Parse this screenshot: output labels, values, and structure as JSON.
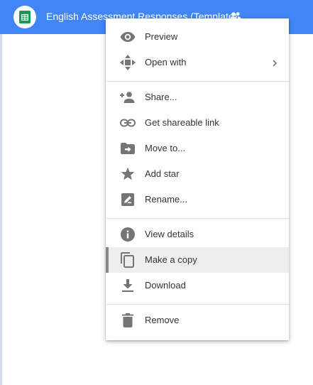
{
  "header": {
    "title": "English Assessment Responses (Template)",
    "file_icon": "google-sheets-icon",
    "shared_icon": "people-icon",
    "bar_color": "#4285f4"
  },
  "menu": {
    "hover_color": "#eeeeee",
    "items": [
      {
        "label": "Preview",
        "icon": "eye-icon"
      },
      {
        "label": "Open with",
        "icon": "move-arrows-icon",
        "submenu": "chevron-right-icon"
      },
      {
        "label": "Share...",
        "icon": "add-person-icon"
      },
      {
        "label": "Get shareable link",
        "icon": "link-icon"
      },
      {
        "label": "Move to...",
        "icon": "folder-move-icon"
      },
      {
        "label": "Add star",
        "icon": "star-icon"
      },
      {
        "label": "Rename...",
        "icon": "rename-icon"
      },
      {
        "label": "View details",
        "icon": "info-icon"
      },
      {
        "label": "Make a copy",
        "icon": "copy-icon",
        "hovered": true
      },
      {
        "label": "Download",
        "icon": "download-icon"
      },
      {
        "label": "Remove",
        "icon": "trash-icon"
      }
    ]
  }
}
